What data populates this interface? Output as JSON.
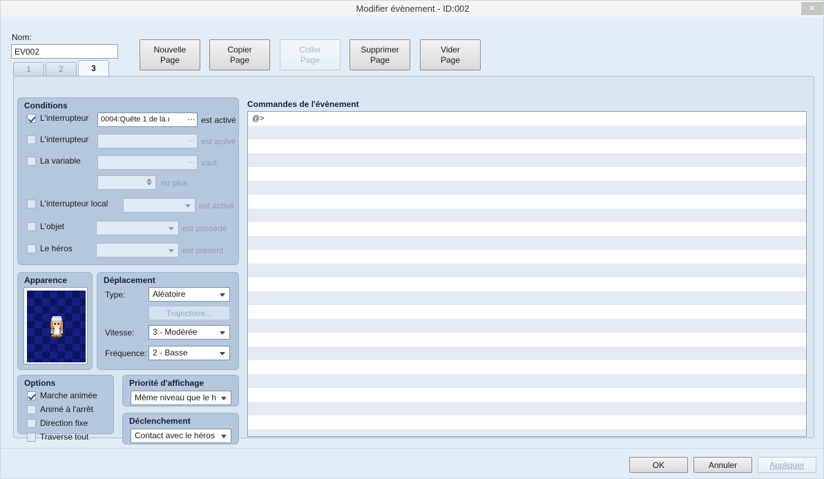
{
  "titlebar": {
    "title": "Modifier évènement - ID:002",
    "close_icon": "close-icon",
    "close_glyph": "✕"
  },
  "header": {
    "name_label": "Nom:",
    "name_value": "EV002",
    "page_buttons": [
      {
        "line1": "Nouvelle",
        "line2": "Page",
        "enabled": true
      },
      {
        "line1": "Copier",
        "line2": "Page",
        "enabled": true
      },
      {
        "line1": "Coller",
        "line2": "Page",
        "enabled": false
      },
      {
        "line1": "Supprimer",
        "line2": "Page",
        "enabled": true
      },
      {
        "line1": "Vider",
        "line2": "Page",
        "enabled": true
      }
    ]
  },
  "tabs": {
    "items": [
      {
        "label": "1",
        "active": false
      },
      {
        "label": "2",
        "active": false
      },
      {
        "label": "3",
        "active": true
      }
    ]
  },
  "conditions": {
    "title": "Conditions",
    "rows": [
      {
        "checkbox_label": "L'interrupteur",
        "checked": true,
        "field_value": "0004:Quête 1 de la ı",
        "ellipsis": "⋯",
        "suffix": "est activé"
      },
      {
        "checkbox_label": "L'interrupteur",
        "checked": false,
        "field_value": "",
        "ellipsis": "⋯",
        "suffix": "est activé"
      },
      {
        "checkbox_label": "La variable",
        "checked": false,
        "field_value": "",
        "ellipsis": "⋯",
        "suffix": "vaut"
      }
    ],
    "variable_spinner": {
      "value": "",
      "suffix": "ou plus"
    },
    "local_switch": {
      "checkbox_label": "L'interrupteur local",
      "checked": false,
      "value": "",
      "suffix": "est activé"
    },
    "item": {
      "checkbox_label": "L'objet",
      "checked": false,
      "value": "",
      "suffix": "est possédé"
    },
    "hero": {
      "checkbox_label": "Le héros",
      "checked": false,
      "value": "",
      "suffix": "est présent"
    }
  },
  "apparence": {
    "title": "Apparence",
    "sprite_name": "character-sprite-maid"
  },
  "deplacement": {
    "title": "Déplacement",
    "type_label": "Type:",
    "type_value": "Aléatoire",
    "trajectory_button": "Trajectoire...",
    "speed_label": "Vitesse:",
    "speed_value": "3 - Modérée",
    "frequency_label": "Fréquence:",
    "frequency_value": "2 - Basse"
  },
  "options": {
    "title": "Options",
    "items": [
      {
        "label": "Marche animée",
        "checked": true
      },
      {
        "label": "Animé à l'arrêt",
        "checked": false
      },
      {
        "label": "Direction fixe",
        "checked": false
      },
      {
        "label": "Traverse tout",
        "checked": false
      }
    ]
  },
  "priorite": {
    "title": "Priorité d'affichage",
    "value": "Même niveau que le h"
  },
  "declenchement": {
    "title": "Déclenchement",
    "value": "Contact avec le héros"
  },
  "commands": {
    "title": "Commandes de l'évènement",
    "rows": [
      "@>",
      "",
      "",
      "",
      "",
      "",
      "",
      "",
      "",
      "",
      "",
      "",
      "",
      "",
      "",
      "",
      "",
      "",
      "",
      "",
      "",
      "",
      "",
      ""
    ]
  },
  "footer": {
    "ok": "OK",
    "cancel": "Annuler",
    "apply": "Appliquer",
    "apply_enabled": false
  },
  "colors": {
    "dialog_bg": "#e2ecf7",
    "group_bg": "#b5c7dd",
    "page_bg": "#d9e6f2",
    "titlebar_bg": "#f4f4f4",
    "accent_border": "#8ca0b5",
    "disabled_text": "#9aa9bb",
    "sprite_bg": "#0d1560"
  }
}
